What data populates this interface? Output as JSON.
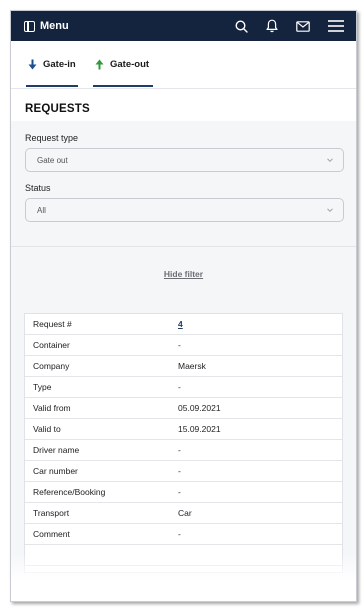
{
  "navbar": {
    "menu_label": "Menu",
    "icons": [
      "search-icon",
      "bell-icon",
      "mail-icon",
      "hamburger-icon"
    ]
  },
  "tabs": [
    {
      "label": "Gate-in",
      "icon": "arrow-down-icon",
      "color": "#1f4f8f"
    },
    {
      "label": "Gate-out",
      "icon": "arrow-up-icon",
      "color": "#2f9a3c"
    }
  ],
  "page": {
    "title": "REQUESTS"
  },
  "filter": {
    "request_type_label": "Request type",
    "request_type_value": "Gate out",
    "status_label": "Status",
    "status_value": "All",
    "hide_filter_label": "Hide filter"
  },
  "request": {
    "rows": [
      {
        "key": "Request #",
        "value": "4"
      },
      {
        "key": "Container",
        "value": "-"
      },
      {
        "key": "Company",
        "value": "Maersk"
      },
      {
        "key": "Type",
        "value": "-"
      },
      {
        "key": "Valid from",
        "value": "05.09.2021"
      },
      {
        "key": "Valid to",
        "value": "15.09.2021"
      },
      {
        "key": "Driver name",
        "value": "-"
      },
      {
        "key": "Car number",
        "value": "-"
      },
      {
        "key": "Reference/Booking",
        "value": "-"
      },
      {
        "key": "Transport",
        "value": "Car"
      },
      {
        "key": "Comment",
        "value": "-"
      },
      {
        "key": "",
        "value": ""
      }
    ]
  },
  "colors": {
    "navbar_bg": "#14243f",
    "accent": "#1f3d66",
    "filter_bg": "#f5f6f8"
  }
}
